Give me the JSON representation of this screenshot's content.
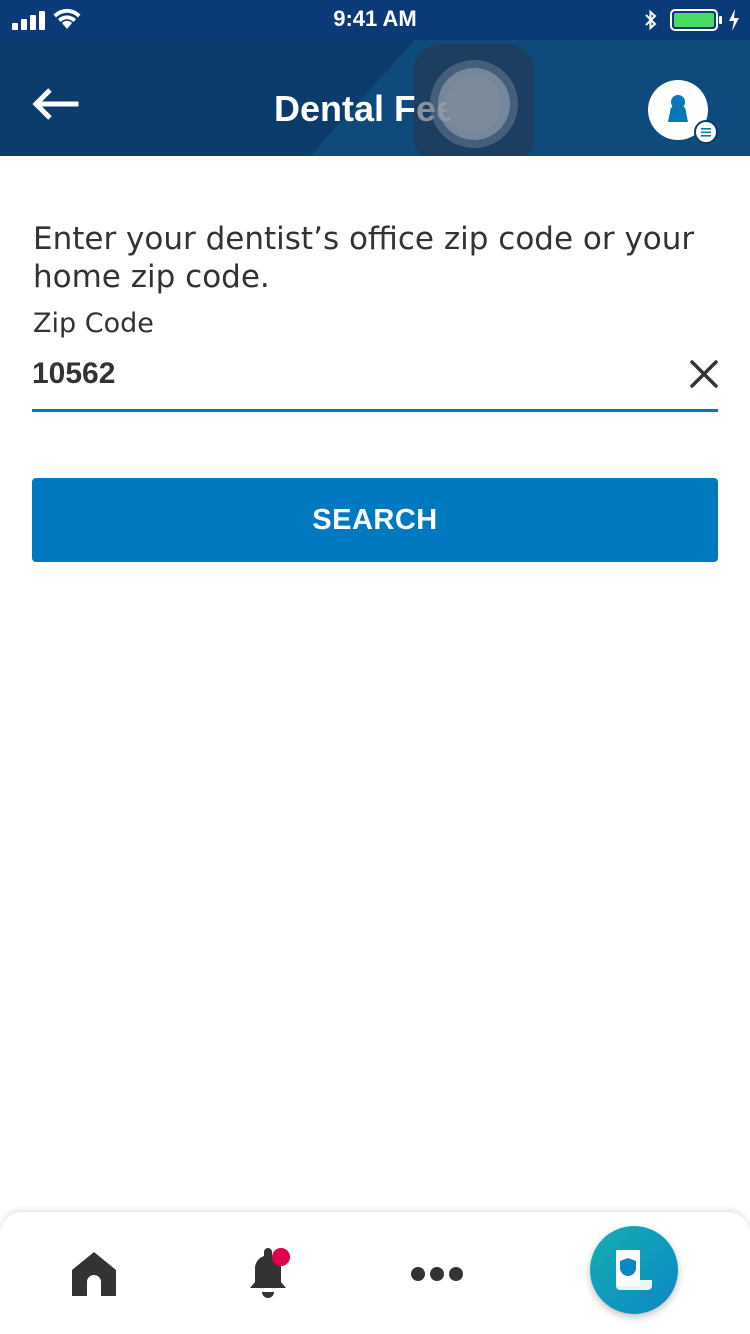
{
  "status_bar": {
    "time": "9:41 AM",
    "icons": [
      "cellular-signal-icon",
      "wifi-icon",
      "bluetooth-icon",
      "battery-icon",
      "charging-icon"
    ],
    "battery_color": "#4cd964"
  },
  "header": {
    "title": "Dental Fees",
    "back_icon": "arrow-left-icon",
    "profile_icon": "user-menu-icon",
    "colors": {
      "background": "#0b3b6a"
    }
  },
  "form": {
    "instruction": "Enter your dentist’s office zip code or your home zip code.",
    "zip_label": "Zip Code",
    "zip_value": "10562",
    "clear_icon": "close-icon",
    "search_label": "SEARCH",
    "accent_color": "#0079c0"
  },
  "bottom_nav": {
    "items": [
      {
        "icon": "home-icon"
      },
      {
        "icon": "bell-icon",
        "has_notification_dot": true
      },
      {
        "icon": "more-icon"
      },
      {
        "icon": "id-card-shield-icon",
        "active": true
      }
    ],
    "notification_dot_color": "#e0004d"
  }
}
